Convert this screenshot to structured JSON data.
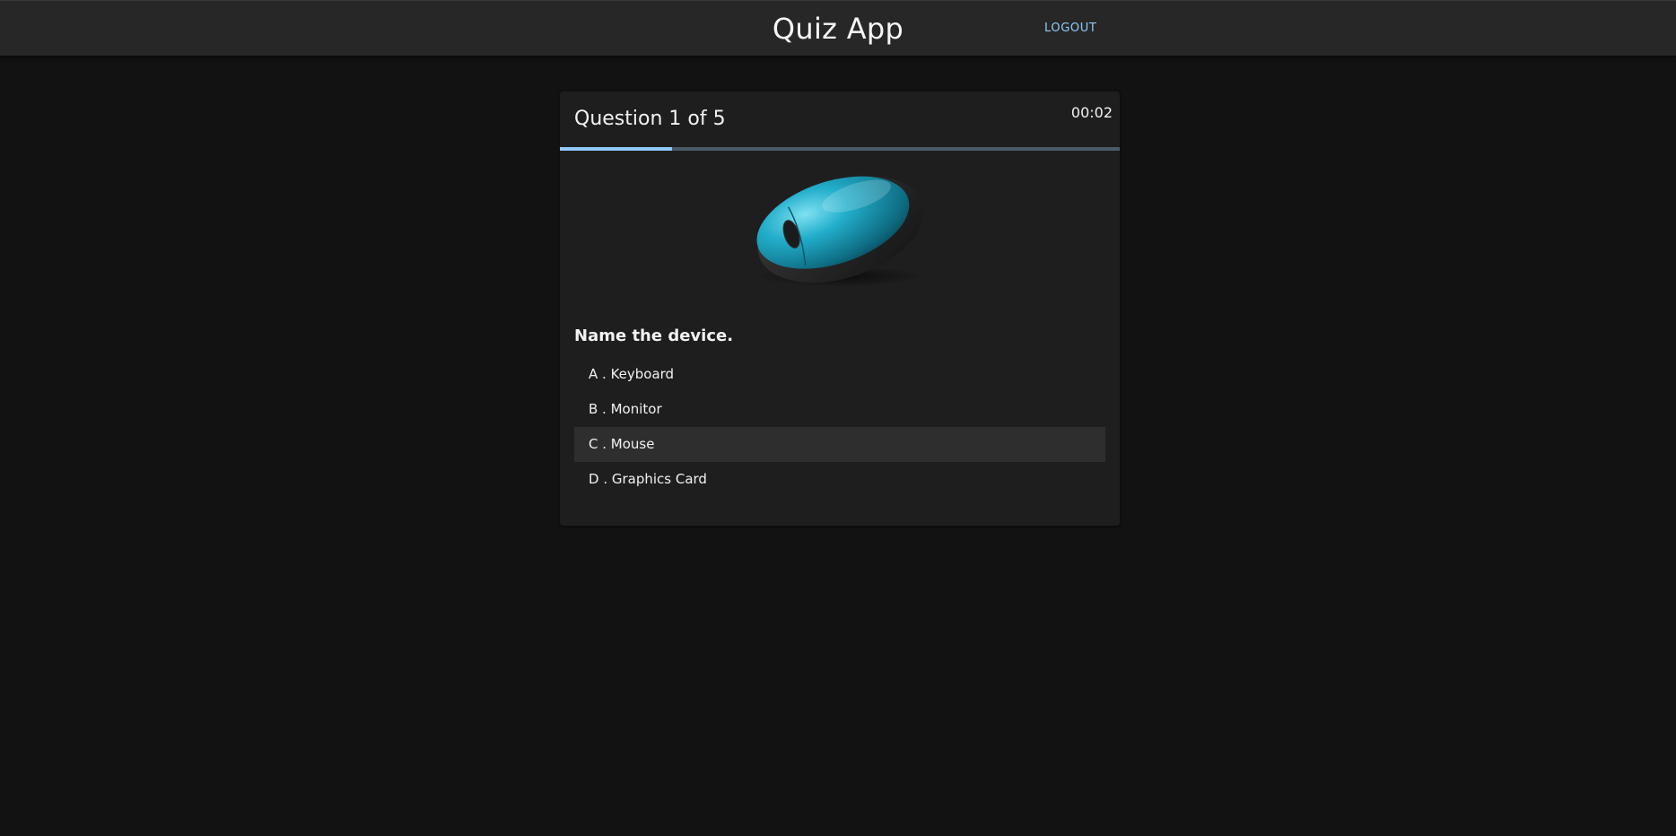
{
  "header": {
    "title": "Quiz App",
    "logout_label": "LOGOUT"
  },
  "quiz": {
    "counter": "Question 1 of 5",
    "timer": "00:02",
    "progress_fraction": 0.2,
    "image_subject": "computer-mouse-icon",
    "prompt": "Name the device.",
    "options": [
      {
        "label": "A . Keyboard",
        "selected": false
      },
      {
        "label": "B . Monitor",
        "selected": false
      },
      {
        "label": "C . Mouse",
        "selected": true
      },
      {
        "label": "D . Graphics Card",
        "selected": false
      }
    ]
  },
  "colors": {
    "accent": "#90caf9",
    "background": "#121212",
    "card": "#1e1e1e",
    "appbar": "#272727",
    "mouse_body": "#1fa3c0"
  }
}
